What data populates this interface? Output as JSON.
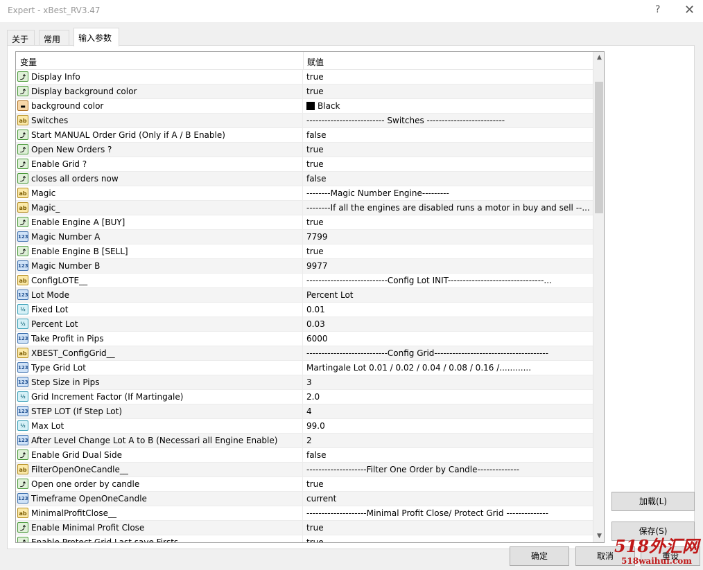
{
  "window": {
    "title": "Expert - xBest_RV3.47",
    "help": "?",
    "close": "✕"
  },
  "tabs": [
    {
      "label": "关于"
    },
    {
      "label": "常用"
    },
    {
      "label": "输入参数"
    }
  ],
  "grid": {
    "columns": [
      "变量",
      "赋值"
    ],
    "rows": [
      {
        "type": "bool",
        "icon": "bool-icon",
        "name": "Display Info",
        "value": "true"
      },
      {
        "type": "bool",
        "icon": "bool-icon",
        "name": "Display background color",
        "value": "true"
      },
      {
        "type": "color",
        "icon": "color-icon",
        "name": "background color",
        "value": "Black",
        "swatch": "#000000"
      },
      {
        "type": "str",
        "icon": "string-icon",
        "name": "Switches",
        "value": "-------------------------- Switches --------------------------"
      },
      {
        "type": "bool",
        "icon": "bool-icon",
        "name": "Start MANUAL Order  Grid  (Only if A / B Enable)",
        "value": "false"
      },
      {
        "type": "bool",
        "icon": "bool-icon",
        "name": "Open New Orders ?",
        "value": "true"
      },
      {
        "type": "bool",
        "icon": "bool-icon",
        "name": "Enable Grid ?",
        "value": "true"
      },
      {
        "type": "bool",
        "icon": "bool-icon",
        "name": "closes all orders now",
        "value": "false"
      },
      {
        "type": "str",
        "icon": "string-icon",
        "name": "Magic",
        "value": "--------Magic Number Engine---------"
      },
      {
        "type": "str",
        "icon": "string-icon",
        "name": "Magic_",
        "value": "--------If all the engines are disabled runs a motor in buy and sell --..."
      },
      {
        "type": "bool",
        "icon": "bool-icon",
        "name": "Enable Engine A   [BUY]",
        "value": "true"
      },
      {
        "type": "int",
        "icon": "int-icon",
        "name": "Magic Number  A",
        "value": "7799"
      },
      {
        "type": "bool",
        "icon": "bool-icon",
        "name": "Enable Engine B   [SELL]",
        "value": "true"
      },
      {
        "type": "int",
        "icon": "int-icon",
        "name": "Magic Number  B",
        "value": "9977"
      },
      {
        "type": "str",
        "icon": "string-icon",
        "name": "ConfigLOTE__",
        "value": "---------------------------Config Lot INIT--------------------------------..."
      },
      {
        "type": "int",
        "icon": "int-icon",
        "name": "Lot Mode",
        "value": "Percent Lot"
      },
      {
        "type": "dbl",
        "icon": "double-icon",
        "name": "Fixed Lot",
        "value": "0.01"
      },
      {
        "type": "dbl",
        "icon": "double-icon",
        "name": "Percent Lot",
        "value": "0.03"
      },
      {
        "type": "int",
        "icon": "int-icon",
        "name": "Take Profit in Pips",
        "value": "6000"
      },
      {
        "type": "str",
        "icon": "string-icon",
        "name": "XBEST_ConfigGrid__",
        "value": "---------------------------Config Grid--------------------------------------"
      },
      {
        "type": "int",
        "icon": "int-icon",
        "name": "Type Grid Lot",
        "value": "Martingale Lot  0.01 / 0.02 / 0.04 / 0.08 / 0.16 /............"
      },
      {
        "type": "int",
        "icon": "int-icon",
        "name": "Step Size in Pips",
        "value": "3"
      },
      {
        "type": "dbl",
        "icon": "double-icon",
        "name": "Grid Increment Factor (If Martingale)",
        "value": "2.0"
      },
      {
        "type": "int",
        "icon": "int-icon",
        "name": "STEP LOT (If  Step Lot)",
        "value": "4"
      },
      {
        "type": "dbl",
        "icon": "double-icon",
        "name": "Max Lot",
        "value": "99.0"
      },
      {
        "type": "int",
        "icon": "int-icon",
        "name": "After Level Change Lot A to B (Necessari all Engine Enable)",
        "value": "2"
      },
      {
        "type": "bool",
        "icon": "bool-icon",
        "name": "Enable Grid Dual Side",
        "value": "false"
      },
      {
        "type": "str",
        "icon": "string-icon",
        "name": "FilterOpenOneCandle__",
        "value": "--------------------Filter One Order by Candle--------------"
      },
      {
        "type": "bool",
        "icon": "bool-icon",
        "name": "Open one order by candle",
        "value": "true"
      },
      {
        "type": "int",
        "icon": "int-icon",
        "name": "Timeframe OpenOneCandle",
        "value": "current"
      },
      {
        "type": "str",
        "icon": "string-icon",
        "name": "MinimalProfitClose__",
        "value": "--------------------Minimal Profit Close/ Protect Grid --------------"
      },
      {
        "type": "bool",
        "icon": "bool-icon",
        "name": "Enable  Minimal Profit Close",
        "value": "true"
      },
      {
        "type": "bool",
        "icon": "bool-icon",
        "name": "Enable Protect Grid Last save Firsts",
        "value": "true"
      }
    ]
  },
  "scrollbar": {
    "up": "▲",
    "down": "▼"
  },
  "buttons": {
    "load": "加载(L)",
    "save": "保存(S)",
    "ok": "确定",
    "cancel": "取消",
    "reset": "重设"
  },
  "watermark": {
    "line1": "518外汇网",
    "line2": "518waihui.com",
    "color": "#c01818"
  },
  "icon_glyphs": {
    "bool": "⤴",
    "str": "ab",
    "int": "123",
    "dbl": "½",
    "color": "▬"
  }
}
